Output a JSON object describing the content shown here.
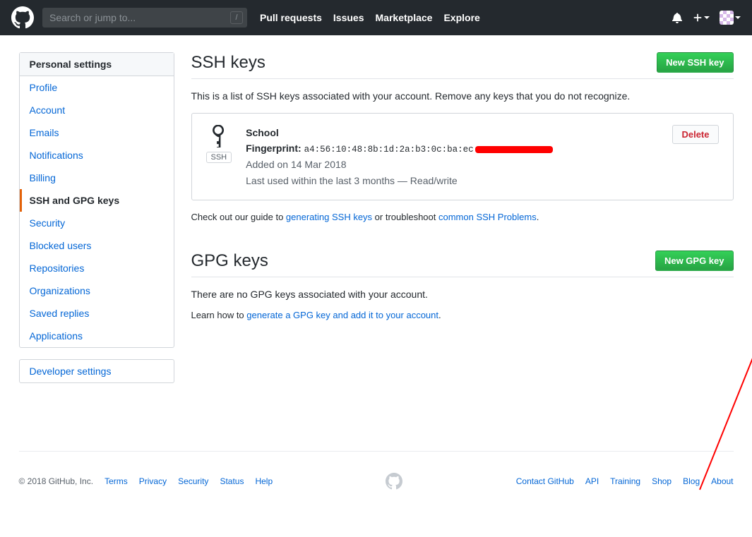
{
  "header": {
    "search_placeholder": "Search or jump to...",
    "slash": "/",
    "nav": [
      "Pull requests",
      "Issues",
      "Marketplace",
      "Explore"
    ]
  },
  "sidebar": {
    "header": "Personal settings",
    "items": [
      {
        "label": "Profile",
        "active": false
      },
      {
        "label": "Account",
        "active": false
      },
      {
        "label": "Emails",
        "active": false
      },
      {
        "label": "Notifications",
        "active": false
      },
      {
        "label": "Billing",
        "active": false
      },
      {
        "label": "SSH and GPG keys",
        "active": true
      },
      {
        "label": "Security",
        "active": false
      },
      {
        "label": "Blocked users",
        "active": false
      },
      {
        "label": "Repositories",
        "active": false
      },
      {
        "label": "Organizations",
        "active": false
      },
      {
        "label": "Saved replies",
        "active": false
      },
      {
        "label": "Applications",
        "active": false
      }
    ],
    "secondary": "Developer settings"
  },
  "ssh": {
    "title": "SSH keys",
    "new_btn": "New SSH key",
    "desc": "This is a list of SSH keys associated with your account. Remove any keys that you do not recognize.",
    "key": {
      "badge": "SSH",
      "name": "School",
      "fp_label": "Fingerprint:",
      "fp_value": "a4:56:10:48:8b:1d:2a:b3:0c:ba:ec",
      "added": "Added on 14 Mar 2018",
      "last": "Last used within the last 3 months — Read/write",
      "delete": "Delete"
    },
    "guide_pre": "Check out our guide to ",
    "guide_link1": "generating SSH keys",
    "guide_mid": " or troubleshoot ",
    "guide_link2": "common SSH Problems",
    "guide_post": "."
  },
  "gpg": {
    "title": "GPG keys",
    "new_btn": "New GPG key",
    "empty": "There are no GPG keys associated with your account.",
    "learn_pre": "Learn how to ",
    "learn_link": "generate a GPG key and add it to your account",
    "learn_post": "."
  },
  "footer": {
    "copyright": "© 2018 GitHub, Inc.",
    "left": [
      "Terms",
      "Privacy",
      "Security",
      "Status",
      "Help"
    ],
    "right": [
      "Contact GitHub",
      "API",
      "Training",
      "Shop",
      "Blog",
      "About"
    ]
  }
}
